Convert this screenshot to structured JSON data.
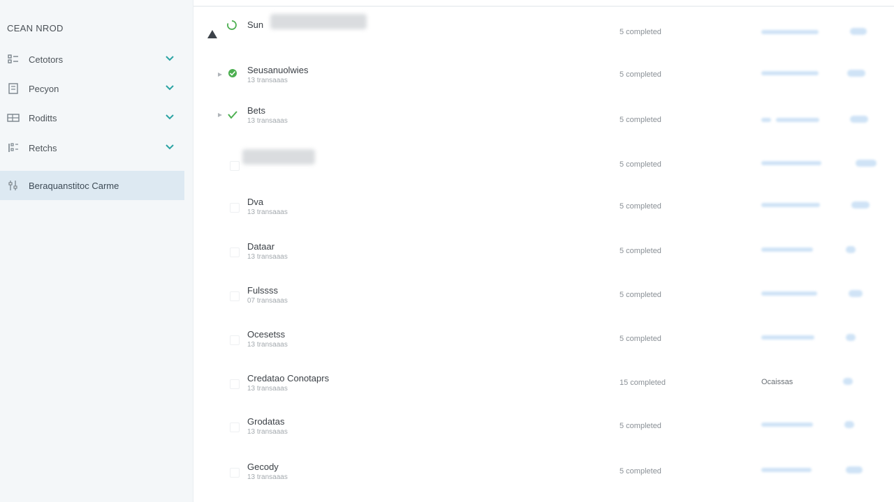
{
  "sidebar": {
    "header": "CEAN NROD",
    "items": [
      {
        "label": "Cetotors",
        "icon": "list-icon",
        "expanded": true
      },
      {
        "label": "Pecyon",
        "icon": "document-icon",
        "expanded": true
      },
      {
        "label": "Roditts",
        "icon": "grid-icon",
        "expanded": true
      },
      {
        "label": "Retchs",
        "icon": "columns-icon",
        "expanded": true
      },
      {
        "label": "Beraquanstitoc Carme",
        "icon": "settings-icon",
        "active": true
      }
    ]
  },
  "colors": {
    "sidebar_bg": "#f4f7f9",
    "active_item_bg": "#dde9f2",
    "chevron": "#2aa3a3",
    "success": "#4caf50",
    "bar": "#cfe3f6"
  },
  "rows": [
    {
      "name": "Sun",
      "sub": "",
      "name_blurred": true,
      "status": "loading",
      "progress": "5 completed",
      "bar_text": ""
    },
    {
      "name": "Seusanuolwies",
      "sub": "13 transaaas",
      "status": "success",
      "progress": "5 completed",
      "bar_text": ""
    },
    {
      "name": "Bets",
      "sub": "13 transaaas",
      "status": "checked",
      "progress": "5 completed",
      "bar_text": ""
    },
    {
      "name": "",
      "sub": "",
      "name_blurred": true,
      "status": "none",
      "progress": "5 completed",
      "bar_text": ""
    },
    {
      "name": "Dva",
      "sub": "13 transaaas",
      "status": "none",
      "progress": "5 completed",
      "bar_text": ""
    },
    {
      "name": "Dataar",
      "sub": "13 transaaas",
      "status": "none",
      "progress": "5 completed",
      "bar_text": ""
    },
    {
      "name": "Fulssss",
      "sub": "07 transaaas",
      "status": "none",
      "progress": "5 completed",
      "bar_text": ""
    },
    {
      "name": "Ocesetss",
      "sub": "13 transaaas",
      "status": "none",
      "progress": "5 completed",
      "bar_text": ""
    },
    {
      "name": "Credatao Conotaprs",
      "sub": "13 transaaas",
      "status": "none",
      "progress": "15 completed",
      "bar_text": "Ocaissas"
    },
    {
      "name": "Grodatas",
      "sub": "13 transaaas",
      "status": "none",
      "progress": "5 completed",
      "bar_text": ""
    },
    {
      "name": "Gecody",
      "sub": "13 transaaas",
      "status": "none",
      "progress": "5 completed",
      "bar_text": ""
    }
  ]
}
